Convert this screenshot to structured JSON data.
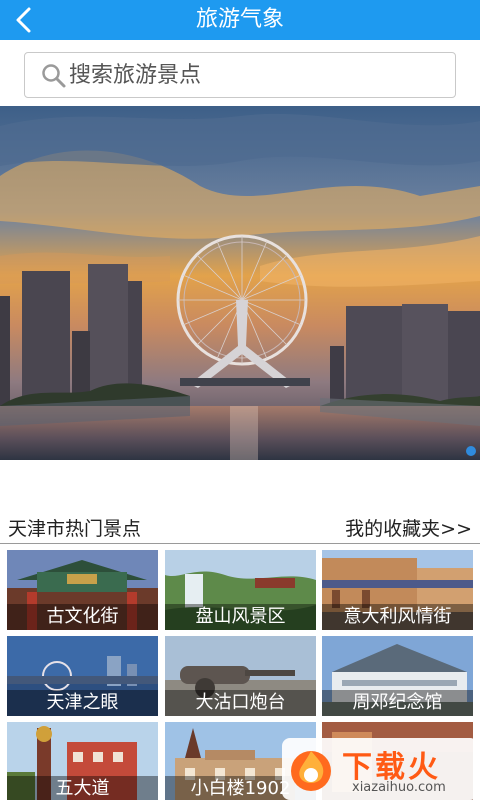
{
  "header": {
    "title": "旅游气象",
    "back_icon": "chevron-left-icon",
    "background": "#1e9af0"
  },
  "search": {
    "placeholder": "搜索旅游景点",
    "icon": "search-icon"
  },
  "banner": {
    "active_index": 0,
    "dot_color": "#2f8bdd"
  },
  "section": {
    "title": "天津市热门景点",
    "favorites_link": "我的收藏夹>>"
  },
  "spots": [
    {
      "name": "古文化街"
    },
    {
      "name": "盘山风景区"
    },
    {
      "name": "意大利风情街"
    },
    {
      "name": "天津之眼"
    },
    {
      "name": "大沽口炮台"
    },
    {
      "name": "周邓纪念馆"
    },
    {
      "name": "五大道"
    },
    {
      "name": "小白楼1902"
    },
    {
      "name": ""
    }
  ],
  "watermark": {
    "text": "下载火",
    "url": "xiazaihuo.com",
    "color": "#ff5a14"
  }
}
